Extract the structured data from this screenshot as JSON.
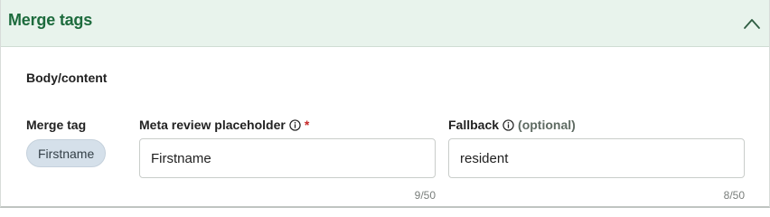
{
  "panel": {
    "title": "Merge tags",
    "expanded": true,
    "accent_color": "#1d6b3d",
    "header_background": "#e8f3ec"
  },
  "section": {
    "label": "Body/content"
  },
  "columns": {
    "merge_tag_label": "Merge tag",
    "placeholder_label": "Meta review placeholder",
    "placeholder_required_marker": "*",
    "fallback_label": "Fallback",
    "fallback_optional_text": "(optional)"
  },
  "row": {
    "merge_tag_chip": "Firstname",
    "placeholder_value": "Firstname",
    "placeholder_counter": "9/50",
    "fallback_value": "resident",
    "fallback_counter": "8/50"
  },
  "icons": {
    "collapse": "chevron-up-icon",
    "info": "info-icon"
  }
}
